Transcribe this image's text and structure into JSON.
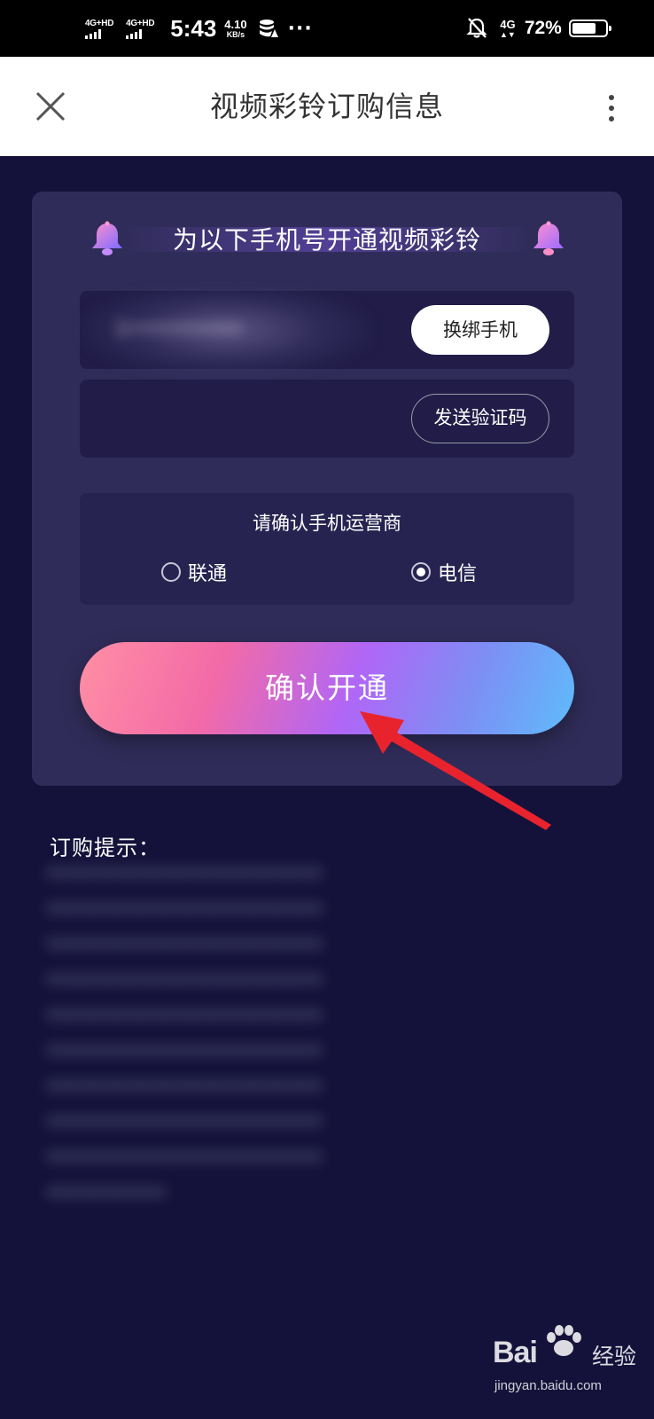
{
  "status_bar": {
    "sim1_label": "4G+HD",
    "sim2_label": "4G+HD",
    "time": "5:43",
    "net_speed_value": "4.10",
    "net_speed_unit": "KB/s",
    "more": "···",
    "network_type": "4G",
    "battery_percent": "72%",
    "battery_level": 0.72
  },
  "header": {
    "title": "视频彩铃订购信息"
  },
  "card": {
    "title": "为以下手机号开通视频彩铃",
    "phone_value": "1••••••••••",
    "rebind_label": "换绑手机",
    "send_code_label": "发送验证码",
    "carrier_prompt": "请确认手机运营商",
    "carrier_options": [
      {
        "label": "联通",
        "selected": false
      },
      {
        "label": "电信",
        "selected": true
      }
    ],
    "confirm_label": "确认开通"
  },
  "tips": {
    "title": "订购提示：",
    "lines": [
      "•••••••••••••••••••••••",
      "•••••••••••••••••••••••",
      "•••••••••••••••••••••••",
      "•••••••••••••••••••••••",
      "•••••••••••••••••••••••",
      "•••••••••••••••••••••••",
      "•••••••••••••••••••••••",
      "•••••••••••••••••••••••",
      "•••••••••••••••••••••••",
      "••••••••••"
    ]
  },
  "watermark": {
    "logo_text": "Bai",
    "logo_suffix": "经验",
    "url": "jingyan.baidu.com"
  },
  "colors": {
    "page_bg": "#14123a",
    "card_bg": "#302c59",
    "field_bg": "#211d48",
    "annotation_arrow": "#e8232e",
    "confirm_gradient_start": "#ff8fa4",
    "confirm_gradient_end": "#5ebcfb"
  },
  "icons": {
    "close": "close-icon",
    "more": "more-vertical-icon",
    "bell": "bell-icon",
    "mute": "bell-off-icon",
    "data_saver": "data-saver-icon"
  }
}
